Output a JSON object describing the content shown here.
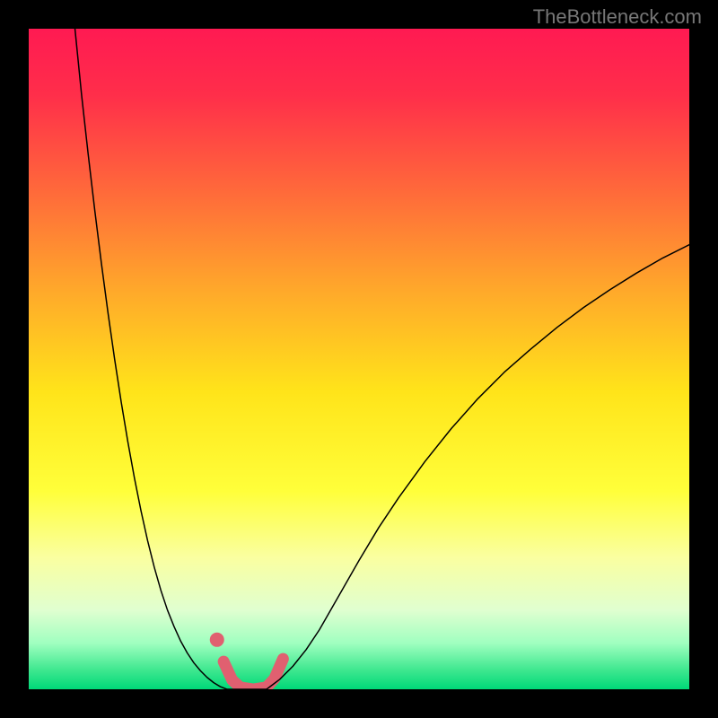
{
  "watermark": "TheBottleneck.com",
  "chart_data": {
    "type": "line",
    "title": "",
    "xlabel": "",
    "ylabel": "",
    "xlim": [
      0,
      100
    ],
    "ylim": [
      0,
      100
    ],
    "background_gradient": {
      "stops": [
        {
          "offset": 0.0,
          "color": "#ff1a52"
        },
        {
          "offset": 0.1,
          "color": "#ff2e4a"
        },
        {
          "offset": 0.25,
          "color": "#ff6b3a"
        },
        {
          "offset": 0.4,
          "color": "#ffaa2a"
        },
        {
          "offset": 0.55,
          "color": "#ffe41a"
        },
        {
          "offset": 0.7,
          "color": "#ffff3a"
        },
        {
          "offset": 0.8,
          "color": "#faffa0"
        },
        {
          "offset": 0.88,
          "color": "#e0ffd0"
        },
        {
          "offset": 0.93,
          "color": "#a0ffc0"
        },
        {
          "offset": 0.97,
          "color": "#40e890"
        },
        {
          "offset": 1.0,
          "color": "#00d878"
        }
      ]
    },
    "series": [
      {
        "name": "left-curve",
        "color": "#000000",
        "width": 1.5,
        "x": [
          7.0,
          8.0,
          9.0,
          10.0,
          11.0,
          12.0,
          13.0,
          14.0,
          15.0,
          16.0,
          17.0,
          18.0,
          19.0,
          20.0,
          21.0,
          22.0,
          23.0,
          24.0,
          25.0,
          26.0,
          27.0,
          28.0,
          29.0,
          30.0
        ],
        "y": [
          100.0,
          90.0,
          81.0,
          72.5,
          64.5,
          57.0,
          50.0,
          43.5,
          37.5,
          32.0,
          27.0,
          22.5,
          18.5,
          15.0,
          12.0,
          9.5,
          7.3,
          5.5,
          4.0,
          2.8,
          1.8,
          1.0,
          0.4,
          0.0
        ]
      },
      {
        "name": "right-curve",
        "color": "#000000",
        "width": 1.5,
        "x": [
          36.0,
          38.0,
          40.0,
          42.0,
          44.0,
          46.0,
          48.0,
          50.0,
          53.0,
          56.0,
          60.0,
          64.0,
          68.0,
          72.0,
          76.0,
          80.0,
          84.0,
          88.0,
          92.0,
          96.0,
          100.0
        ],
        "y": [
          0.0,
          1.5,
          3.5,
          6.0,
          9.0,
          12.5,
          16.0,
          19.5,
          24.5,
          29.0,
          34.5,
          39.5,
          44.0,
          48.0,
          51.5,
          54.8,
          57.8,
          60.5,
          63.0,
          65.3,
          67.3
        ]
      },
      {
        "name": "flat-bottom",
        "color": "#000000",
        "width": 1.5,
        "x": [
          30.0,
          36.0
        ],
        "y": [
          0.0,
          0.0
        ]
      },
      {
        "name": "highlight-band",
        "color": "#e06070",
        "width": 13,
        "linecap": "round",
        "x": [
          29.5,
          30.8,
          32.0,
          34.0,
          36.0,
          37.2,
          38.5
        ],
        "y": [
          4.2,
          1.4,
          0.3,
          0.0,
          0.3,
          1.6,
          4.6
        ]
      }
    ],
    "markers": [
      {
        "name": "highlight-dot",
        "x": 28.5,
        "y": 7.5,
        "r": 8,
        "color": "#e06070"
      }
    ]
  }
}
